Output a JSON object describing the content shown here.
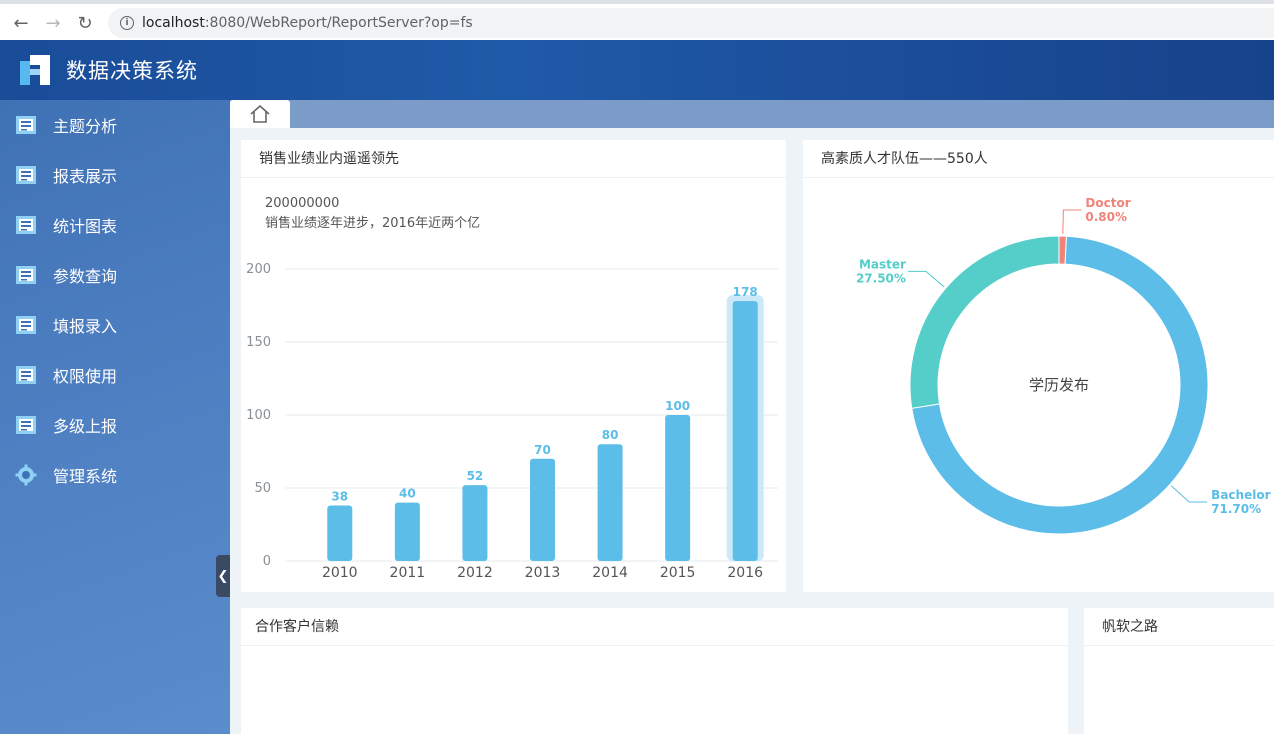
{
  "browser": {
    "url_host": "localhost",
    "url_rest": ":8080/WebReport/ReportServer?op=fs"
  },
  "app": {
    "title": "数据决策系统"
  },
  "sidebar": {
    "items": [
      {
        "label": "主题分析",
        "icon": "report-icon"
      },
      {
        "label": "报表展示",
        "icon": "report-icon"
      },
      {
        "label": "统计图表",
        "icon": "report-icon"
      },
      {
        "label": "参数查询",
        "icon": "report-icon"
      },
      {
        "label": "填报录入",
        "icon": "report-icon"
      },
      {
        "label": "权限使用",
        "icon": "report-icon"
      },
      {
        "label": "多级上报",
        "icon": "report-icon"
      },
      {
        "label": "管理系统",
        "icon": "gear-icon"
      }
    ]
  },
  "cards": {
    "sales": {
      "title": "销售业绩业内遥遥领先",
      "headline": "200000000",
      "subtitle": "销售业绩逐年进步，2016年近两个亿"
    },
    "talent": {
      "title": "高素质人才队伍——550人"
    },
    "clients": {
      "title": "合作客户信赖"
    },
    "road": {
      "title": "帆软之路"
    }
  },
  "chart_data": [
    {
      "type": "bar",
      "categories": [
        "2010",
        "2011",
        "2012",
        "2013",
        "2014",
        "2015",
        "2016"
      ],
      "values": [
        38,
        40,
        52,
        70,
        80,
        100,
        178
      ],
      "ylim": [
        0,
        200
      ],
      "yticks": [
        0,
        50,
        100,
        150,
        200
      ],
      "highlight_category": "2016",
      "color": "#5bbde8"
    },
    {
      "type": "pie",
      "center_label": "学历发布",
      "slices": [
        {
          "name": "Doctor",
          "value": 0.8,
          "label": "0.80%",
          "color": "#f0837a"
        },
        {
          "name": "Bachelor",
          "value": 71.7,
          "label": "71.70%",
          "color": "#5bbde8"
        },
        {
          "name": "Master",
          "value": 27.5,
          "label": "27.50%",
          "color": "#55cdc8"
        }
      ]
    }
  ]
}
